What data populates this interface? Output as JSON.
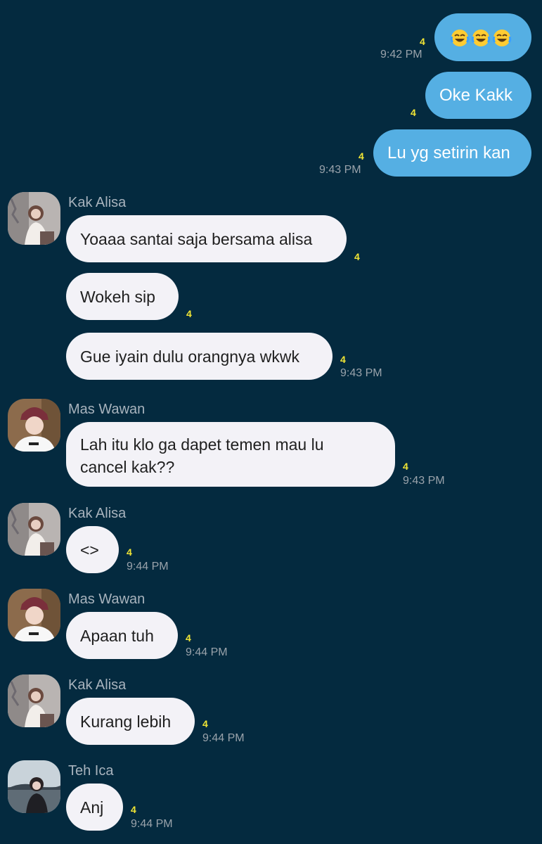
{
  "colors": {
    "background": "#042a3f",
    "outgoing_bubble": "#55afe3",
    "incoming_bubble": "#f3f2f7",
    "read_count": "#f1e535",
    "timestamp": "#9aa3ab",
    "sender_name": "#a8b3bd"
  },
  "messages": [
    {
      "dir": "out",
      "text": "😂😂😂",
      "emoji_icon": "tears-of-joy-emoji",
      "count": "4",
      "time": "9:42 PM"
    },
    {
      "dir": "out",
      "text": "Oke Kakk",
      "count": "4",
      "time": ""
    },
    {
      "dir": "out",
      "text": "Lu yg setirin kan",
      "count": "4",
      "time": "9:43 PM"
    },
    {
      "dir": "in",
      "sender": "Kak Alisa",
      "text": "Yoaaa santai saja bersama alisa",
      "count": "4",
      "time": ""
    },
    {
      "dir": "in",
      "text": "Wokeh sip",
      "count": "4",
      "time": ""
    },
    {
      "dir": "in",
      "text": "Gue iyain dulu orangnya wkwk",
      "count": "4",
      "time": "9:43 PM"
    },
    {
      "dir": "in",
      "sender": "Mas Wawan",
      "text_line1": "Lah itu klo ga dapet temen mau lu",
      "text_line2": "cancel kak??",
      "count": "4",
      "time": "9:43 PM"
    },
    {
      "dir": "in",
      "sender": "Kak Alisa",
      "text": "<>",
      "count": "4",
      "time": "9:44 PM"
    },
    {
      "dir": "in",
      "sender": "Mas Wawan",
      "text": "Apaan tuh",
      "count": "4",
      "time": "9:44 PM"
    },
    {
      "dir": "in",
      "sender": "Kak Alisa",
      "text": "Kurang lebih",
      "count": "4",
      "time": "9:44 PM"
    },
    {
      "dir": "in",
      "sender": "Teh Ica",
      "text": "Anj",
      "count": "4",
      "time": "9:44 PM"
    }
  ]
}
